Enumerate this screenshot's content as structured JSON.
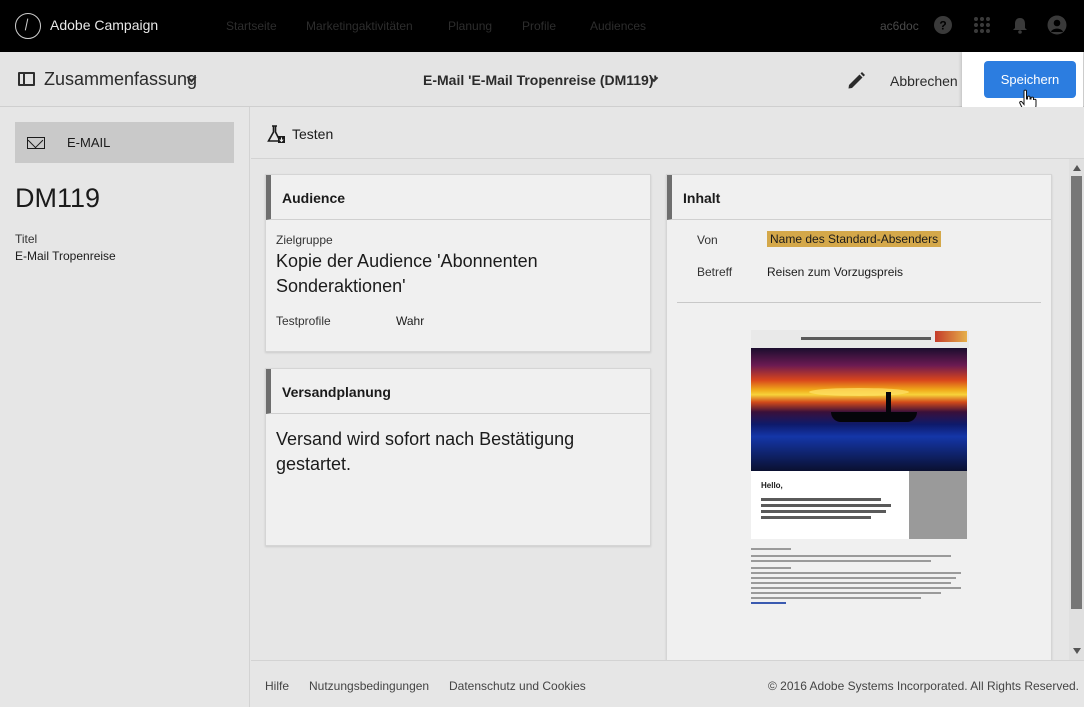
{
  "topbar": {
    "app_title": "Adobe Campaign",
    "nav": [
      "Startseite",
      "Marketingaktivitäten",
      "Planung",
      "Profile",
      "Audiences"
    ],
    "user": "ac6doc"
  },
  "header": {
    "summary_label": "Zusammenfassung",
    "email_title": "E-Mail 'E-Mail Tropenreise (DM119)'",
    "cancel_label": "Abbrechen",
    "save_label": "Speichern"
  },
  "left": {
    "tab_label": "E-MAIL",
    "code": "DM119",
    "title_label": "Titel",
    "title_value": "E-Mail Tropenreise"
  },
  "main": {
    "test_label": "Testen",
    "audience": {
      "heading": "Audience",
      "target_label": "Zielgruppe",
      "target_value": "Kopie der Audience 'Abonnenten Sonderaktionen'",
      "test_label": "Testprofile",
      "test_value": "Wahr"
    },
    "schedule": {
      "heading": "Versandplanung",
      "text": "Versand wird sofort nach Bestätigung gestartet."
    },
    "content": {
      "heading": "Inhalt",
      "from_label": "Von",
      "from_value": "Name des Standard-Absenders",
      "from_highlight": "#d4a84a",
      "subject_label": "Betreff",
      "subject_value": "Reisen zum Vorzugspreis",
      "preview_hello": "Hello,"
    }
  },
  "footer": {
    "help": "Hilfe",
    "terms": "Nutzungsbedingungen",
    "privacy": "Datenschutz und Cookies",
    "copyright": "© 2016 Adobe Systems Incorporated. All Rights Reserved."
  }
}
